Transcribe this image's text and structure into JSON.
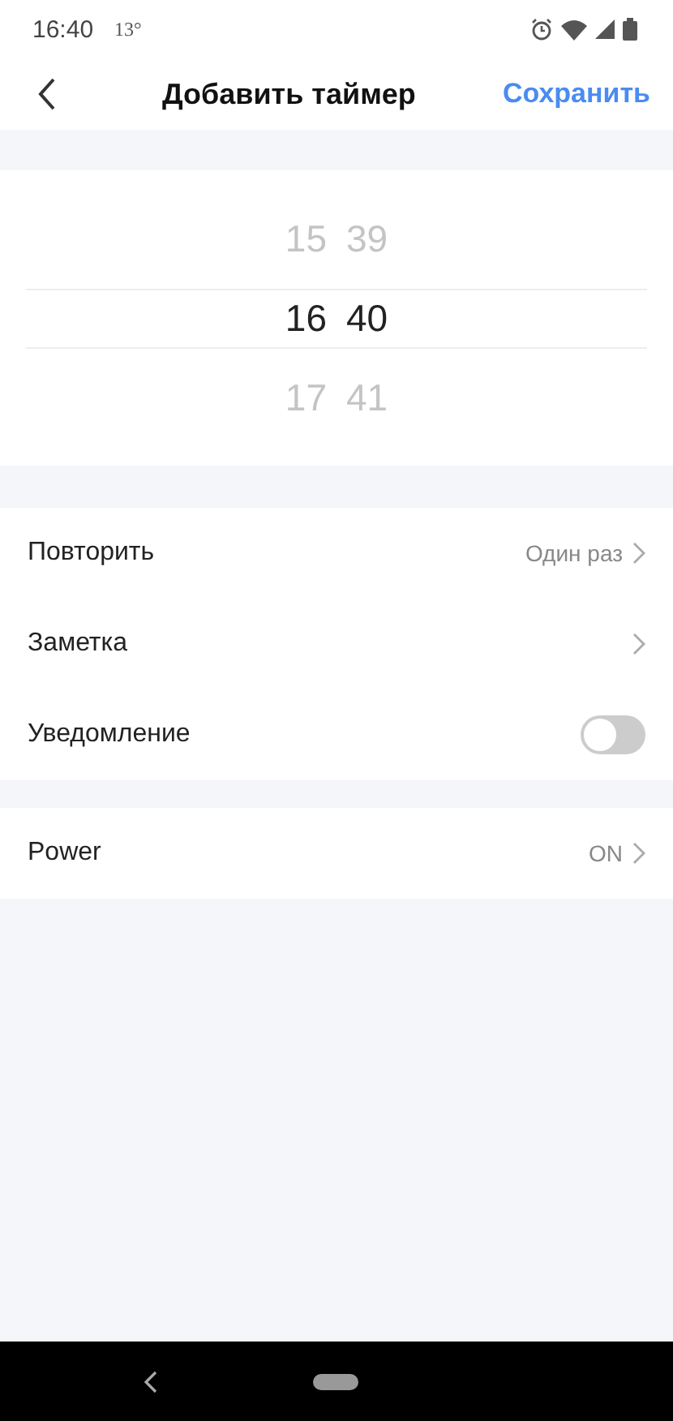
{
  "status_bar": {
    "time": "16:40",
    "temperature": "13°"
  },
  "header": {
    "title": "Добавить таймер",
    "action": "Сохранить"
  },
  "picker": {
    "rows": [
      {
        "hour": "15",
        "minute": "39",
        "selected": false
      },
      {
        "hour": "16",
        "minute": "40",
        "selected": true
      },
      {
        "hour": "17",
        "minute": "41",
        "selected": false
      }
    ]
  },
  "settings": [
    {
      "kind": "value",
      "label": "Повторить",
      "value": "Один раз"
    },
    {
      "kind": "link",
      "label": "Заметка"
    },
    {
      "kind": "toggle",
      "label": "Уведомление",
      "on": false
    }
  ],
  "actions": [
    {
      "kind": "value",
      "label": "Power",
      "value": "ON"
    }
  ]
}
